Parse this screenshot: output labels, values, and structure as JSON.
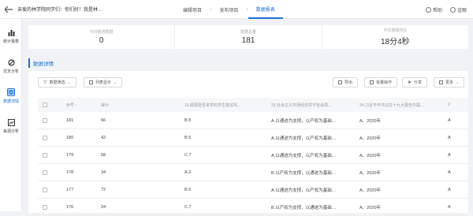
{
  "topbar": {
    "survey_title": "亲爱的林学院同学们：你们好！我是林…",
    "steps": [
      "编辑项目",
      "发布项目",
      "数据报表"
    ],
    "help_label": "帮助",
    "user_label": "金眼"
  },
  "sidebar": {
    "items": [
      {
        "label": "统计报表",
        "icon": "bar-chart-icon"
      },
      {
        "label": "交叉分析",
        "icon": "cross-analysis-icon"
      },
      {
        "label": "数据详情",
        "icon": "document-icon"
      },
      {
        "label": "来源分析",
        "icon": "image-chart-icon"
      }
    ]
  },
  "stats": [
    {
      "label": "今日新增数据",
      "value": "0"
    },
    {
      "label": "数据总量",
      "value": "181"
    },
    {
      "label": "平均答题时长",
      "value": "18分4秒"
    }
  ],
  "section_title": "数据详情",
  "toolbar": {
    "filter_label": "数据筛选",
    "columns_label": "列表显示",
    "export_label": "导出",
    "batch_label": "批量操作",
    "share_label": "分享",
    "more_label": "更多"
  },
  "table": {
    "headers": [
      "序号",
      "得分",
      "15.网更能否来学的学生建议风…",
      "23.社会主义市场经济并不社会领…",
      "24.习近平作书记在十九大报告中提…",
      "2"
    ],
    "rows": [
      [
        "181",
        "66",
        "B.5",
        "A.以通迹为支撑，以产权为基础…",
        "A、2020年",
        "A"
      ],
      [
        "180",
        "42",
        "B.5",
        "A.以通迹为支撑，以产权为基础…",
        "A、2020年",
        "A"
      ],
      [
        "179",
        "58",
        "C.7",
        "A.以通迹为支撑，以产权为基础…",
        "A、2020年",
        "A"
      ],
      [
        "178",
        "34",
        "A.3",
        "B.以产权为支撑，以通迹为基础…",
        "A、2020年",
        "A"
      ],
      [
        "177",
        "72",
        "B.5",
        "A.以通迹为支撑，以产权为基础…",
        "A、2020年",
        "A"
      ],
      [
        "176",
        "24",
        "C.7",
        "B.以产权为支撑，以通迹为基础…",
        "A、2020年",
        "A"
      ]
    ]
  }
}
